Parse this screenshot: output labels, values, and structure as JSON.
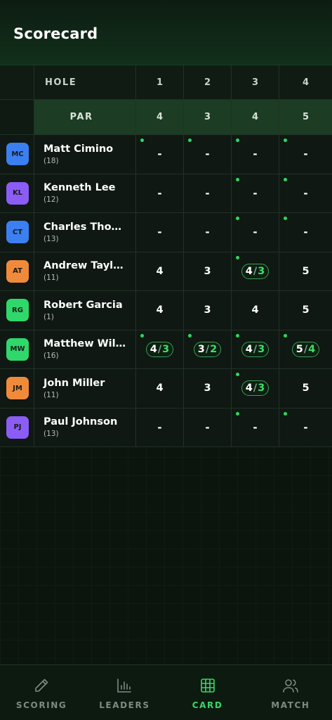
{
  "header": {
    "title": "Scorecard"
  },
  "table": {
    "hole_label": "HOLE",
    "par_label": "PAR",
    "holes": [
      "1",
      "2",
      "3",
      "4"
    ],
    "pars": [
      "4",
      "3",
      "4",
      "5"
    ],
    "players": [
      {
        "initials": "MC",
        "color": "#3b7ff0",
        "name": "Matt Cimino",
        "hcp": "(18)",
        "dots": [
          true,
          true,
          true,
          true
        ],
        "scores": [
          {
            "t": "dash",
            "v": "-"
          },
          {
            "t": "dash",
            "v": "-"
          },
          {
            "t": "dash",
            "v": "-"
          },
          {
            "t": "dash",
            "v": "-"
          }
        ]
      },
      {
        "initials": "KL",
        "color": "#8b5cf6",
        "name": "Kenneth Lee",
        "hcp": "(12)",
        "dots": [
          false,
          false,
          true,
          true
        ],
        "scores": [
          {
            "t": "dash",
            "v": "-"
          },
          {
            "t": "dash",
            "v": "-"
          },
          {
            "t": "dash",
            "v": "-"
          },
          {
            "t": "dash",
            "v": "-"
          }
        ]
      },
      {
        "initials": "CT",
        "color": "#3b7ff0",
        "name": "Charles Tho…",
        "hcp": "(13)",
        "dots": [
          false,
          false,
          true,
          true
        ],
        "scores": [
          {
            "t": "dash",
            "v": "-"
          },
          {
            "t": "dash",
            "v": "-"
          },
          {
            "t": "dash",
            "v": "-"
          },
          {
            "t": "dash",
            "v": "-"
          }
        ]
      },
      {
        "initials": "AT",
        "color": "#f08a3b",
        "name": "Andrew Tayl…",
        "hcp": "(11)",
        "dots": [
          false,
          false,
          true,
          false
        ],
        "scores": [
          {
            "t": "num",
            "v": "4"
          },
          {
            "t": "num",
            "v": "3"
          },
          {
            "t": "pill",
            "g": "4",
            "n": "3"
          },
          {
            "t": "num",
            "v": "5"
          }
        ]
      },
      {
        "initials": "RG",
        "color": "#2fd86a",
        "name": "Robert Garcia",
        "hcp": "(1)",
        "dots": [
          false,
          false,
          false,
          false
        ],
        "scores": [
          {
            "t": "num",
            "v": "4"
          },
          {
            "t": "num",
            "v": "3"
          },
          {
            "t": "num",
            "v": "4"
          },
          {
            "t": "num",
            "v": "5"
          }
        ]
      },
      {
        "initials": "MW",
        "color": "#2fd86a",
        "name": "Matthew Wil…",
        "hcp": "(16)",
        "dots": [
          true,
          true,
          true,
          true
        ],
        "scores": [
          {
            "t": "pill",
            "g": "4",
            "n": "3"
          },
          {
            "t": "pill",
            "g": "3",
            "n": "2"
          },
          {
            "t": "pill",
            "g": "4",
            "n": "3"
          },
          {
            "t": "pill",
            "g": "5",
            "n": "4"
          }
        ]
      },
      {
        "initials": "JM",
        "color": "#f08a3b",
        "name": "John Miller",
        "hcp": "(11)",
        "dots": [
          false,
          false,
          true,
          false
        ],
        "scores": [
          {
            "t": "num",
            "v": "4"
          },
          {
            "t": "num",
            "v": "3"
          },
          {
            "t": "pill",
            "g": "4",
            "n": "3"
          },
          {
            "t": "num",
            "v": "5"
          }
        ]
      },
      {
        "initials": "PJ",
        "color": "#8b5cf6",
        "name": "Paul Johnson",
        "hcp": "(13)",
        "dots": [
          false,
          false,
          true,
          true
        ],
        "scores": [
          {
            "t": "dash",
            "v": "-"
          },
          {
            "t": "dash",
            "v": "-"
          },
          {
            "t": "dash",
            "v": "-"
          },
          {
            "t": "dash",
            "v": "-"
          }
        ]
      }
    ]
  },
  "nav": {
    "items": [
      {
        "label": "SCORING",
        "icon": "pencil-icon",
        "active": false
      },
      {
        "label": "LEADERS",
        "icon": "bar-chart-icon",
        "active": false
      },
      {
        "label": "CARD",
        "icon": "grid-icon",
        "active": true
      },
      {
        "label": "MATCH",
        "icon": "users-icon",
        "active": false
      }
    ]
  },
  "colors": {
    "accent": "#37d867",
    "background": "#0c140e",
    "par_row": "#1c3c24"
  }
}
